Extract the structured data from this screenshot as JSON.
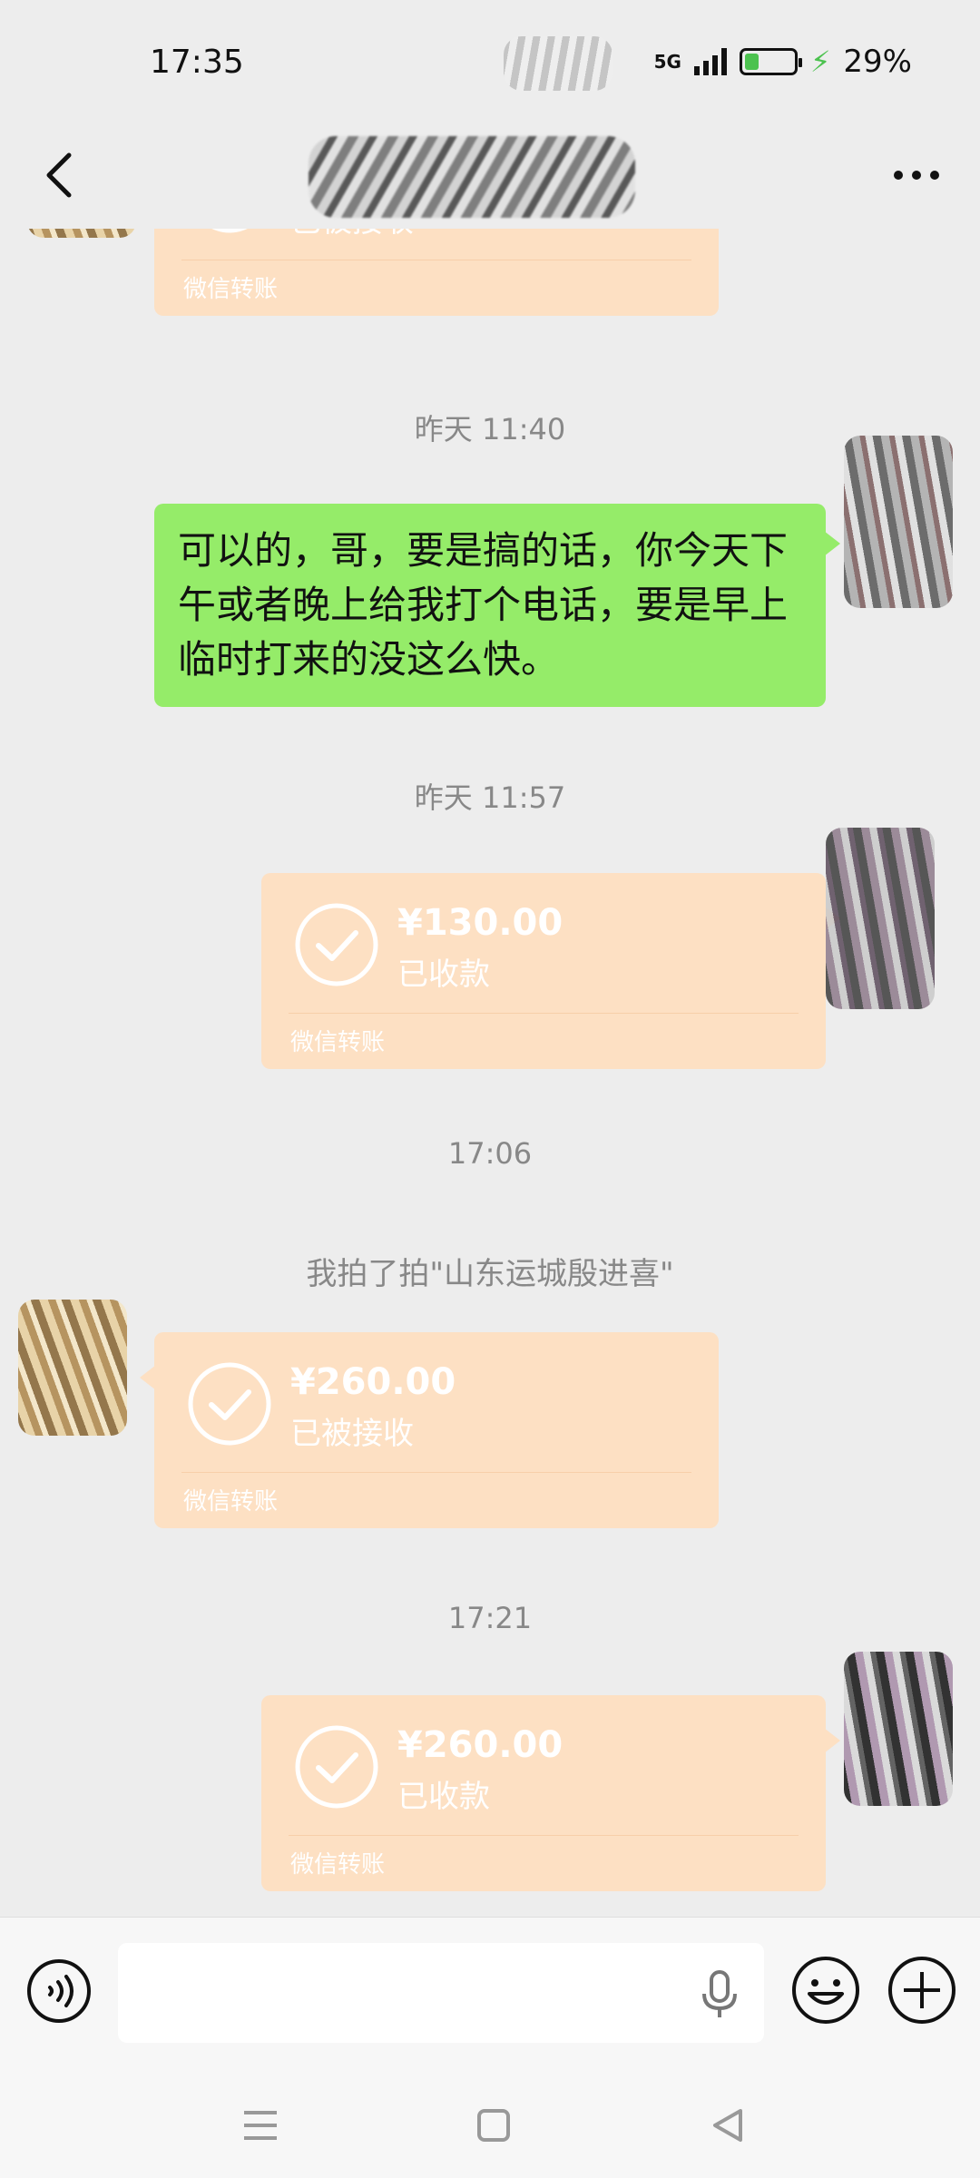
{
  "status_bar": {
    "time": "17:35",
    "network": "5G",
    "battery_percent": "29%",
    "battery_level": 0.29
  },
  "header": {
    "more_label": "···"
  },
  "messages": {
    "ts1": "昨天 11:40",
    "green_text": "可以的，哥，要是搞的话，你今天下午或者晚上给我打个电话，要是早上临时打来的没这么快。",
    "ts2": "昨天 11:57",
    "ts3": "17:06",
    "system_pat": "我拍了拍\"山东运城殷进喜\"",
    "ts4": "17:21"
  },
  "transfers": [
    {
      "amount": "",
      "state": "已被接收",
      "label": "微信转账",
      "side": "left"
    },
    {
      "amount": "¥130.00",
      "state": "已收款",
      "label": "微信转账",
      "side": "right"
    },
    {
      "amount": "¥260.00",
      "state": "已被接收",
      "label": "微信转账",
      "side": "left"
    },
    {
      "amount": "¥260.00",
      "state": "已收款",
      "label": "微信转账",
      "side": "right"
    }
  ],
  "input": {
    "placeholder": ""
  },
  "icons": {
    "back": "chevron-left-icon",
    "more": "more-dots-icon",
    "voice": "voice-icon",
    "mic": "microphone-icon",
    "emoji": "emoji-icon",
    "plus": "plus-icon",
    "nav_menu": "menu-icon",
    "nav_home": "home-square-icon",
    "nav_back": "back-triangle-icon"
  },
  "colors": {
    "background": "#ededed",
    "green_bubble": "#95ec69",
    "transfer_bubble": "#fde0c3",
    "battery_fill": "#4cc24f"
  }
}
